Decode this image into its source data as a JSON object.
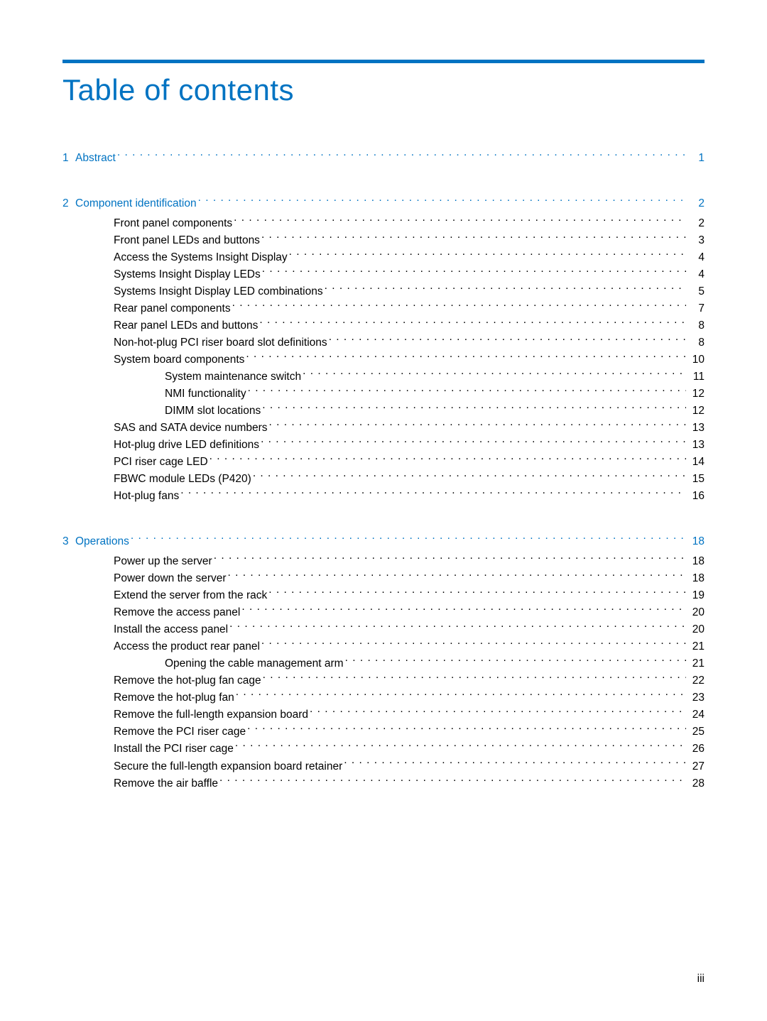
{
  "title": "Table of contents",
  "page_number": "iii",
  "sections": [
    {
      "num": "1",
      "label": "Abstract",
      "page": "1",
      "items": []
    },
    {
      "num": "2",
      "label": "Component identification",
      "page": "2",
      "items": [
        {
          "label": "Front panel components",
          "page": "2",
          "indent": 1
        },
        {
          "label": "Front panel LEDs and buttons",
          "page": "3",
          "indent": 1
        },
        {
          "label": "Access the Systems Insight Display",
          "page": "4",
          "indent": 1
        },
        {
          "label": "Systems Insight Display LEDs",
          "page": "4",
          "indent": 1
        },
        {
          "label": "Systems Insight Display LED combinations",
          "page": "5",
          "indent": 1
        },
        {
          "label": "Rear panel components",
          "page": "7",
          "indent": 1
        },
        {
          "label": "Rear panel LEDs and buttons",
          "page": "8",
          "indent": 1
        },
        {
          "label": "Non-hot-plug PCI riser board slot definitions",
          "page": "8",
          "indent": 1
        },
        {
          "label": "System board components",
          "page": "10",
          "indent": 1
        },
        {
          "label": "System maintenance switch",
          "page": "11",
          "indent": 2
        },
        {
          "label": "NMI functionality",
          "page": "12",
          "indent": 2
        },
        {
          "label": "DIMM slot locations",
          "page": "12",
          "indent": 2
        },
        {
          "label": "SAS and SATA device numbers",
          "page": "13",
          "indent": 1
        },
        {
          "label": "Hot-plug drive LED definitions",
          "page": "13",
          "indent": 1
        },
        {
          "label": "PCI riser cage LED",
          "page": "14",
          "indent": 1
        },
        {
          "label": "FBWC module LEDs (P420)",
          "page": "15",
          "indent": 1
        },
        {
          "label": "Hot-plug fans",
          "page": "16",
          "indent": 1
        }
      ]
    },
    {
      "num": "3",
      "label": "Operations",
      "page": "18",
      "items": [
        {
          "label": "Power up the server",
          "page": "18",
          "indent": 1
        },
        {
          "label": "Power down the server",
          "page": "18",
          "indent": 1
        },
        {
          "label": "Extend the server from the rack",
          "page": "19",
          "indent": 1
        },
        {
          "label": "Remove the access panel",
          "page": "20",
          "indent": 1
        },
        {
          "label": "Install the access panel",
          "page": "20",
          "indent": 1
        },
        {
          "label": "Access the product rear panel",
          "page": "21",
          "indent": 1
        },
        {
          "label": "Opening the cable management arm",
          "page": "21",
          "indent": 2
        },
        {
          "label": "Remove the hot-plug fan cage",
          "page": "22",
          "indent": 1
        },
        {
          "label": "Remove the hot-plug fan",
          "page": "23",
          "indent": 1
        },
        {
          "label": "Remove the full-length expansion board",
          "page": "24",
          "indent": 1
        },
        {
          "label": "Remove the PCI riser cage",
          "page": "25",
          "indent": 1
        },
        {
          "label": "Install the PCI riser cage",
          "page": "26",
          "indent": 1
        },
        {
          "label": "Secure the full-length expansion board retainer",
          "page": "27",
          "indent": 1
        },
        {
          "label": "Remove the air baffle",
          "page": "28",
          "indent": 1
        }
      ]
    }
  ]
}
